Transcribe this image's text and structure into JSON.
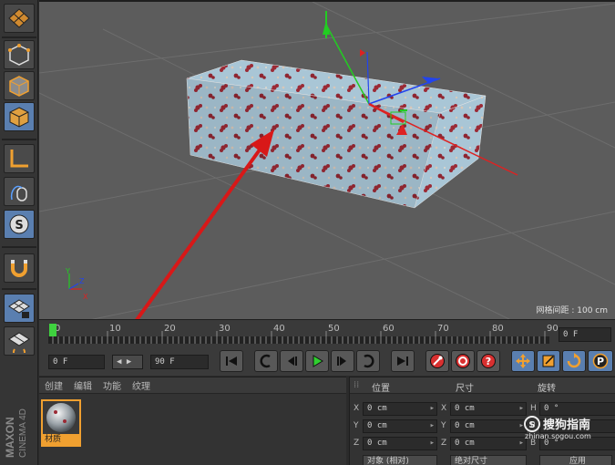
{
  "viewport": {
    "grid_spacing_label": "网格间距 : 100 cm"
  },
  "timeline": {
    "ticks": [
      "0",
      "10",
      "20",
      "30",
      "40",
      "50",
      "60",
      "70",
      "80",
      "90"
    ],
    "end_frame_field": "0 F"
  },
  "transport": {
    "current_frame": "0 F",
    "max_frame": "90 F"
  },
  "material_manager": {
    "menu": [
      "创建",
      "编辑",
      "功能",
      "纹理"
    ],
    "material_name": "材质"
  },
  "coordinates": {
    "headers": {
      "position": "位置",
      "size": "尺寸",
      "rotation": "旋转"
    },
    "rows": [
      {
        "pos_axis": "X",
        "pos_value": "0 cm",
        "size_axis": "X",
        "size_value": "0 cm",
        "rot_axis": "H",
        "rot_value": "0 °"
      },
      {
        "pos_axis": "Y",
        "pos_value": "0 cm",
        "size_axis": "Y",
        "size_value": "0 cm",
        "rot_axis": "P",
        "rot_value": "0 °"
      },
      {
        "pos_axis": "Z",
        "pos_value": "0 cm",
        "size_axis": "Z",
        "size_value": "0 cm",
        "rot_axis": "B",
        "rot_value": "0 °"
      }
    ],
    "mode_dropdown": "对象 (相对)",
    "size_dropdown": "绝对尺寸",
    "apply_button": "应用"
  },
  "branding": {
    "maxon": "MAXON",
    "cinema": "CINEMA 4D"
  },
  "watermark": {
    "title": "搜狗指南",
    "url": "zhinan.sogou.com"
  },
  "colors": {
    "accent_orange": "#f0a030",
    "active_blue": "#5a7fb0",
    "annotation_arrow": "#d81818",
    "axis_y": "#22cc22",
    "axis_x": "#dd2222",
    "axis_z": "#2244ee"
  }
}
